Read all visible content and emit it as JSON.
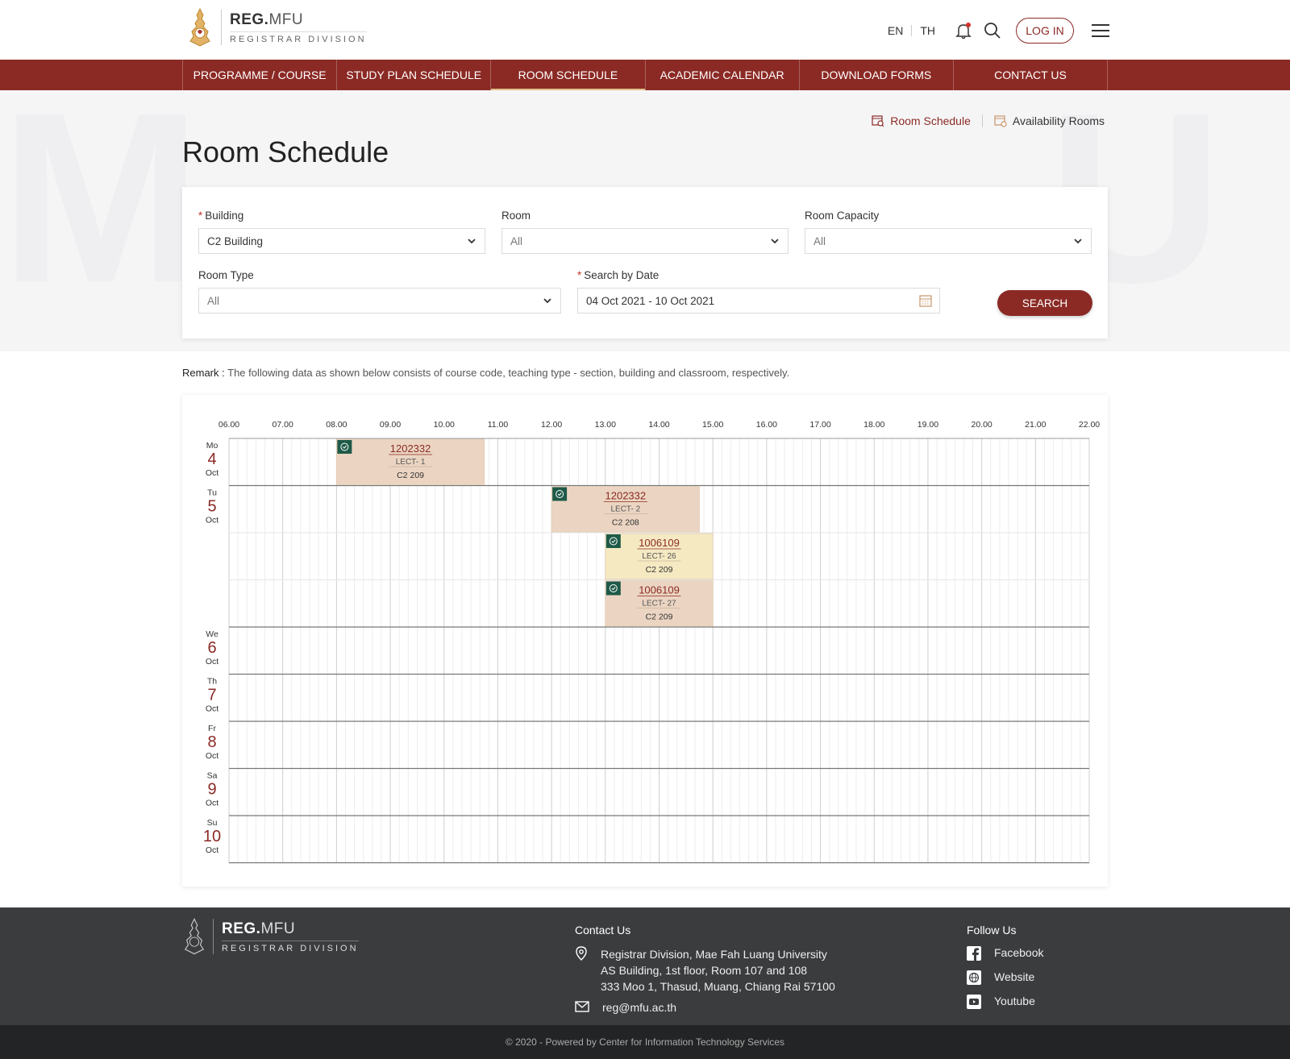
{
  "header": {
    "logo_main": "REG.",
    "logo_main_dim": "MFU",
    "logo_sub": "REGISTRAR DIVISION",
    "lang_en": "EN",
    "lang_th": "TH",
    "login_label": "LOG IN"
  },
  "nav": {
    "items": [
      {
        "label": "PROGRAMME / COURSE"
      },
      {
        "label": "STUDY PLAN SCHEDULE"
      },
      {
        "label": "ROOM SCHEDULE",
        "active": true
      },
      {
        "label": "ACADEMIC CALENDAR"
      },
      {
        "label": "DOWNLOAD FORMS"
      },
      {
        "label": "CONTACT US"
      }
    ]
  },
  "quick_links": {
    "room_schedule": "Room Schedule",
    "availability_rooms": "Availability Rooms"
  },
  "page_title": "Room Schedule",
  "filter": {
    "building_label": "Building",
    "building_value": "C2 Building",
    "room_label": "Room",
    "room_value": "All",
    "capacity_label": "Room Capacity",
    "capacity_value": "All",
    "type_label": "Room Type",
    "type_value": "All",
    "date_label": "Search by Date",
    "date_value": "04 Oct 2021 - 10 Oct 2021",
    "required_mark": "*",
    "search_label": "SEARCH"
  },
  "remark": {
    "label": "Remark :",
    "text": "The following data as shown below consists of course code, teaching type - section, building and classroom, respectively."
  },
  "timetable": {
    "hours": [
      "06.00",
      "07.00",
      "08.00",
      "09.00",
      "10.00",
      "11.00",
      "12.00",
      "13.00",
      "14.00",
      "15.00",
      "16.00",
      "17.00",
      "18.00",
      "19.00",
      "20.00",
      "21.00",
      "22.00"
    ],
    "days": [
      {
        "dow": "Mo",
        "day": "4",
        "month": "Oct",
        "lanes": 1
      },
      {
        "dow": "Tu",
        "day": "5",
        "month": "Oct",
        "lanes": 3
      },
      {
        "dow": "We",
        "day": "6",
        "month": "Oct",
        "lanes": 1
      },
      {
        "dow": "Th",
        "day": "7",
        "month": "Oct",
        "lanes": 1
      },
      {
        "dow": "Fr",
        "day": "8",
        "month": "Oct",
        "lanes": 1
      },
      {
        "dow": "Sa",
        "day": "9",
        "month": "Oct",
        "lanes": 1
      },
      {
        "dow": "Su",
        "day": "10",
        "month": "Oct",
        "lanes": 1
      }
    ],
    "events": [
      {
        "day_index": 0,
        "lane": 0,
        "start": "08.00",
        "end": "10.45",
        "code": "1202332",
        "type": "LECT- 1",
        "room": "C2 209",
        "color": "#ebd5c2"
      },
      {
        "day_index": 1,
        "lane": 0,
        "start": "12.00",
        "end": "14.45",
        "code": "1202332",
        "type": "LECT- 2",
        "room": "C2 208",
        "color": "#ebd5c2"
      },
      {
        "day_index": 1,
        "lane": 1,
        "start": "13.00",
        "end": "15.00",
        "code": "1006109",
        "type": "LECT- 26",
        "room": "C2 209",
        "color": "#f5e9c2"
      },
      {
        "day_index": 1,
        "lane": 2,
        "start": "13.00",
        "end": "15.00",
        "code": "1006109",
        "type": "LECT- 27",
        "room": "C2 209",
        "color": "#ebd5c2"
      }
    ],
    "badge_color": "#1f5a48"
  },
  "footer": {
    "contact_title": "Contact Us",
    "address_1": "Registrar Division, Mae Fah Luang University",
    "address_2": "AS Building, 1st floor, Room 107 and 108",
    "address_3": "333 Moo 1, Thasud, Muang, Chiang Rai 57100",
    "email": "reg@mfu.ac.th",
    "follow_title": "Follow Us",
    "facebook": "Facebook",
    "website": "Website",
    "youtube": "Youtube",
    "copyright": "© 2020 - Powered by Center for Information Technology Services"
  },
  "colors": {
    "brand": "#8b2a25",
    "footer_bg": "#3a3c3e",
    "copyright_bg": "#232425"
  }
}
